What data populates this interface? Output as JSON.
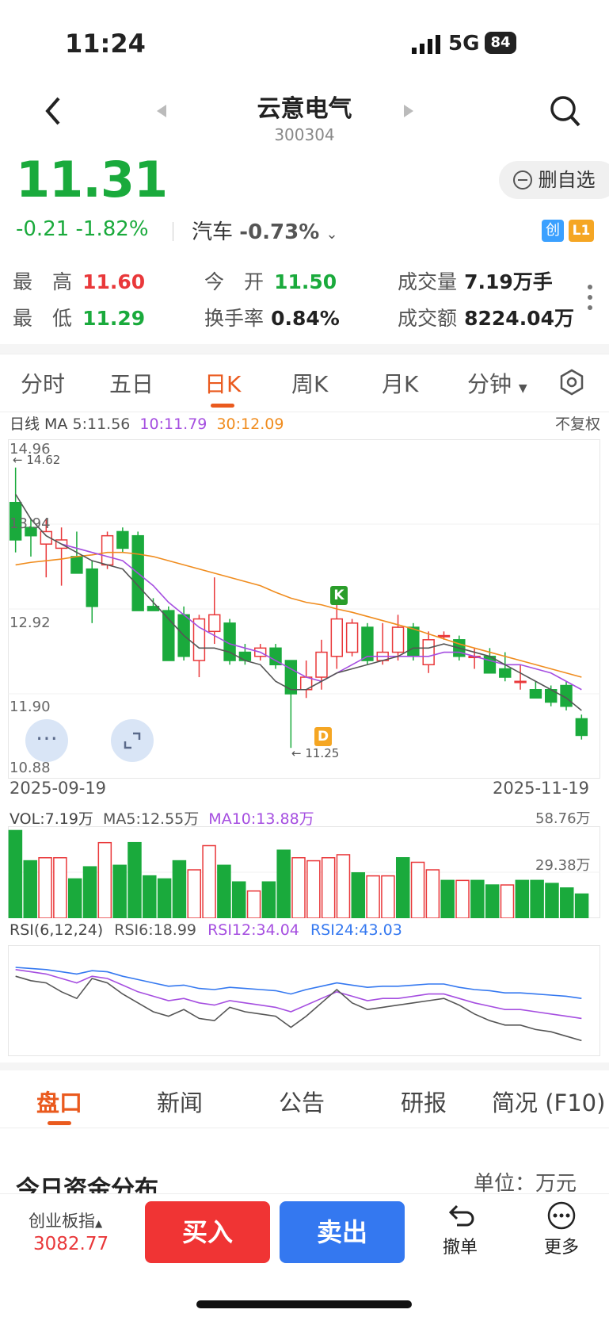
{
  "status": {
    "time": "11:24",
    "network": "5G",
    "battery": "84"
  },
  "header": {
    "title": "云意电气",
    "code": "300304"
  },
  "quote": {
    "price": "11.31",
    "change": "-0.21",
    "change_pct": "-1.82%",
    "sector_name": "汽车",
    "sector_pct": "-0.73%",
    "fav_label": "删自选",
    "badge_chuang": "创",
    "badge_l1": "L1"
  },
  "stats": {
    "high_label": "最　高",
    "high": "11.60",
    "low_label": "最　低",
    "low": "11.29",
    "open_label": "今　开",
    "open": "11.50",
    "turnover_label": "换手率",
    "turnover": "0.84%",
    "volume_label": "成交量",
    "volume": "7.19万手",
    "amount_label": "成交额",
    "amount": "8224.04万"
  },
  "tabs": [
    "分时",
    "五日",
    "日K",
    "周K",
    "月K",
    "分钟"
  ],
  "ma": {
    "label": "日线 MA",
    "ma5": "5:11.56",
    "ma10": "10:11.79",
    "ma30": "30:12.09",
    "adjust": "不复权"
  },
  "kline_axis": {
    "top": "14.96",
    "l2": "13.94",
    "l3": "12.92",
    "l4": "11.90",
    "bottom": "10.88",
    "max_mark": "14.62",
    "min_mark": "11.25",
    "k_mark": "K",
    "d_mark": "D",
    "date_start": "2025-09-19",
    "date_end": "2025-11-19"
  },
  "vol": {
    "label": "VOL:7.19万",
    "ma5": "MA5:12.55万",
    "ma10": "MA10:13.88万",
    "top": "58.76万",
    "mid": "29.38万"
  },
  "rsi": {
    "label": "RSI(6,12,24)",
    "r6": "RSI6:18.99",
    "r12": "RSI12:34.04",
    "r24": "RSI24:43.03"
  },
  "bottom_tabs": [
    "盘口",
    "新闻",
    "公告",
    "研报",
    "简况 (F10)"
  ],
  "section": {
    "title": "今日资金分布",
    "unit": "单位：万元"
  },
  "footer": {
    "index_name": "创业板指",
    "index_value": "3082.77",
    "buy": "买入",
    "sell": "卖出",
    "undo": "撤单",
    "more": "更多"
  },
  "colors": {
    "up": "#e9383a",
    "down": "#1aaa3c",
    "accent": "#ea5a1e",
    "ma10": "#a54ee0",
    "ma30": "#f08c1e",
    "rsi24": "#3478f0"
  },
  "chart_data": {
    "type": "candlestick",
    "ylim": [
      10.88,
      14.96
    ],
    "candles": [
      {
        "o": 14.2,
        "h": 14.62,
        "l": 13.6,
        "c": 13.75
      },
      {
        "o": 13.9,
        "h": 14.0,
        "l": 13.55,
        "c": 13.8
      },
      {
        "o": 13.7,
        "h": 14.0,
        "l": 13.3,
        "c": 13.85
      },
      {
        "o": 13.65,
        "h": 13.9,
        "l": 13.2,
        "c": 13.75
      },
      {
        "o": 13.55,
        "h": 13.85,
        "l": 13.4,
        "c": 13.35
      },
      {
        "o": 13.4,
        "h": 13.5,
        "l": 12.75,
        "c": 12.95
      },
      {
        "o": 13.45,
        "h": 13.85,
        "l": 13.4,
        "c": 13.8
      },
      {
        "o": 13.85,
        "h": 13.9,
        "l": 13.6,
        "c": 13.65
      },
      {
        "o": 13.8,
        "h": 13.85,
        "l": 12.95,
        "c": 12.9
      },
      {
        "o": 12.95,
        "h": 13.05,
        "l": 12.9,
        "c": 12.9
      },
      {
        "o": 12.9,
        "h": 12.95,
        "l": 12.35,
        "c": 12.3
      },
      {
        "o": 12.85,
        "h": 12.95,
        "l": 12.3,
        "c": 12.35
      },
      {
        "o": 12.3,
        "h": 12.85,
        "l": 12.1,
        "c": 12.8
      },
      {
        "o": 12.65,
        "h": 13.3,
        "l": 12.5,
        "c": 12.85
      },
      {
        "o": 12.75,
        "h": 12.8,
        "l": 12.25,
        "c": 12.3
      },
      {
        "o": 12.4,
        "h": 12.5,
        "l": 12.25,
        "c": 12.3
      },
      {
        "o": 12.35,
        "h": 12.5,
        "l": 12.3,
        "c": 12.45
      },
      {
        "o": 12.45,
        "h": 12.5,
        "l": 12.2,
        "c": 12.25
      },
      {
        "o": 12.3,
        "h": 12.3,
        "l": 11.25,
        "c": 11.9
      },
      {
        "o": 11.95,
        "h": 12.3,
        "l": 11.85,
        "c": 12.1
      },
      {
        "o": 12.1,
        "h": 12.55,
        "l": 11.95,
        "c": 12.4
      },
      {
        "o": 12.35,
        "h": 13.0,
        "l": 12.2,
        "c": 12.8
      },
      {
        "o": 12.4,
        "h": 12.8,
        "l": 12.35,
        "c": 12.75
      },
      {
        "o": 12.7,
        "h": 12.75,
        "l": 12.25,
        "c": 12.3
      },
      {
        "o": 12.3,
        "h": 12.75,
        "l": 12.25,
        "c": 12.4
      },
      {
        "o": 12.4,
        "h": 12.85,
        "l": 12.3,
        "c": 12.7
      },
      {
        "o": 12.7,
        "h": 12.75,
        "l": 12.3,
        "c": 12.35
      },
      {
        "o": 12.25,
        "h": 12.65,
        "l": 12.15,
        "c": 12.55
      },
      {
        "o": 12.6,
        "h": 12.65,
        "l": 12.55,
        "c": 12.6
      },
      {
        "o": 12.55,
        "h": 12.6,
        "l": 12.3,
        "c": 12.35
      },
      {
        "o": 12.35,
        "h": 12.45,
        "l": 12.2,
        "c": 12.35
      },
      {
        "o": 12.35,
        "h": 12.45,
        "l": 12.15,
        "c": 12.15
      },
      {
        "o": 12.2,
        "h": 12.4,
        "l": 12.05,
        "c": 12.1
      },
      {
        "o": 12.05,
        "h": 12.25,
        "l": 11.95,
        "c": 12.05
      },
      {
        "o": 11.95,
        "h": 12.05,
        "l": 11.85,
        "c": 11.85
      },
      {
        "o": 11.95,
        "h": 12.0,
        "l": 11.75,
        "c": 11.8
      },
      {
        "o": 12.0,
        "h": 12.05,
        "l": 11.7,
        "c": 11.75
      },
      {
        "o": 11.6,
        "h": 11.65,
        "l": 11.35,
        "c": 11.4
      }
    ],
    "ma5": [
      14.3,
      14.0,
      13.8,
      13.7,
      13.6,
      13.5,
      13.45,
      13.4,
      13.2,
      13.0,
      12.8,
      12.6,
      12.45,
      12.45,
      12.4,
      12.3,
      12.25,
      12.05,
      11.95,
      11.95,
      12.05,
      12.15,
      12.2,
      12.25,
      12.3,
      12.35,
      12.45,
      12.45,
      12.5,
      12.45,
      12.4,
      12.35,
      12.25,
      12.15,
      12.05,
      11.95,
      11.85,
      11.7
    ],
    "ma10": [
      null,
      null,
      null,
      13.7,
      13.65,
      13.6,
      13.55,
      13.5,
      13.35,
      13.2,
      13.0,
      12.85,
      12.7,
      12.6,
      12.5,
      12.45,
      12.4,
      12.3,
      12.2,
      12.1,
      12.05,
      12.15,
      12.25,
      12.35,
      12.35,
      12.35,
      12.35,
      12.35,
      12.4,
      12.4,
      12.35,
      12.3,
      12.25,
      12.25,
      12.2,
      12.15,
      12.05,
      11.95
    ],
    "ma30": [
      13.45,
      13.48,
      13.5,
      13.52,
      13.55,
      13.57,
      13.6,
      13.6,
      13.58,
      13.55,
      13.5,
      13.45,
      13.4,
      13.35,
      13.3,
      13.25,
      13.2,
      13.12,
      13.05,
      13.0,
      12.97,
      12.92,
      12.88,
      12.83,
      12.78,
      12.73,
      12.68,
      12.62,
      12.56,
      12.5,
      12.45,
      12.4,
      12.35,
      12.3,
      12.25,
      12.2,
      12.15,
      12.1
    ],
    "volume": [
      58,
      38,
      40,
      40,
      26,
      34,
      50,
      35,
      50,
      28,
      26,
      38,
      32,
      48,
      35,
      24,
      18,
      24,
      45,
      40,
      38,
      40,
      42,
      30,
      28,
      28,
      40,
      37,
      32,
      25,
      25,
      25,
      22,
      22,
      25,
      25,
      23,
      20,
      16
    ],
    "rsi6": [
      72,
      68,
      66,
      58,
      52,
      70,
      66,
      56,
      48,
      40,
      36,
      42,
      34,
      32,
      44,
      40,
      38,
      36,
      26,
      36,
      48,
      60,
      48,
      42,
      44,
      46,
      48,
      50,
      52,
      46,
      38,
      32,
      28,
      28,
      24,
      22,
      18,
      14
    ],
    "rsi12": [
      78,
      76,
      74,
      70,
      66,
      72,
      70,
      64,
      58,
      54,
      50,
      52,
      48,
      46,
      50,
      48,
      46,
      44,
      40,
      46,
      52,
      58,
      54,
      50,
      52,
      52,
      54,
      56,
      56,
      52,
      48,
      45,
      42,
      42,
      40,
      38,
      36,
      34
    ],
    "rsi24": [
      80,
      79,
      78,
      76,
      74,
      77,
      76,
      72,
      69,
      66,
      63,
      64,
      61,
      60,
      62,
      61,
      60,
      59,
      56,
      60,
      63,
      66,
      64,
      62,
      63,
      63,
      64,
      65,
      65,
      62,
      60,
      59,
      57,
      57,
      56,
      55,
      54,
      52
    ]
  }
}
